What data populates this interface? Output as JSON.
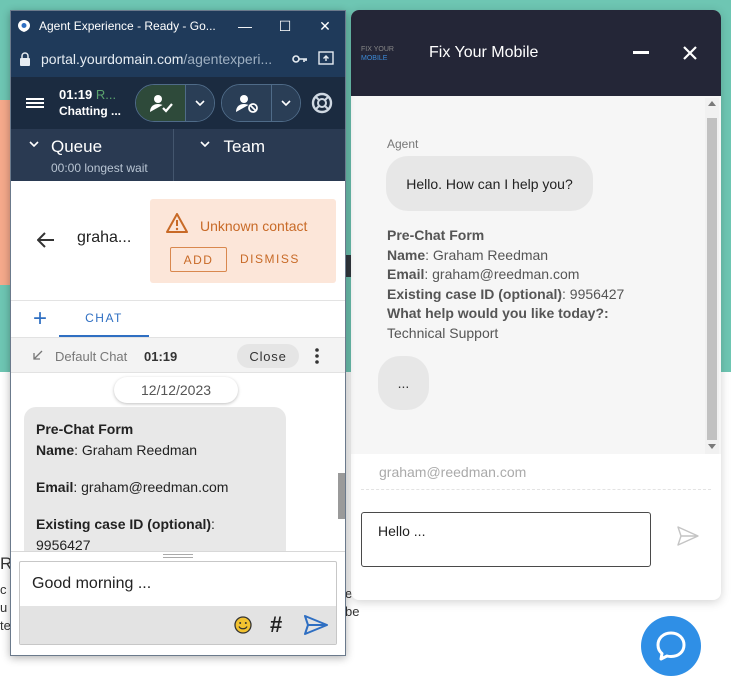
{
  "background": {
    "left_text_big": "R",
    "left_text_lines": [
      "c",
      "u",
      "te"
    ],
    "right_text_lines": [
      "e",
      "be"
    ]
  },
  "agent_window": {
    "title": "Agent Experience - Ready - Go...",
    "url_host": "portal.yourdomain.com",
    "url_path": "/agentexperi...",
    "timer": "01:19",
    "ready_short": "R...",
    "status_text": "Chatting ...",
    "queue": {
      "label": "Queue",
      "sub": "00:00 longest wait"
    },
    "team": {
      "label": "Team"
    },
    "contact_name": "graha...",
    "unknown_contact": {
      "label": "Unknown contact",
      "add": "ADD",
      "dismiss": "DISMISS"
    },
    "tab_chat": "CHAT",
    "tab_plus": "+",
    "chat_info": {
      "name": "Default Chat",
      "time": "01:19",
      "close": "Close"
    },
    "date": "12/12/2023",
    "message": {
      "title": "Pre-Chat Form",
      "name_label": "Name",
      "name_value": ": Graham Reedman",
      "email_label": "Email",
      "email_value": ": graham@reedman.com",
      "case_label": "Existing case ID (optional)",
      "case_value": ":",
      "case_number": "9956427"
    },
    "composer_text": "Good morning ...",
    "hash": "#"
  },
  "widget": {
    "logo_line1": "FIX YOUR",
    "logo_line2": "MOBILE",
    "title": "Fix Your Mobile",
    "agent_label": "Agent",
    "agent_message": "Hello. How can I help you?",
    "form": {
      "title": "Pre-Chat Form",
      "name_label": "Name",
      "name_value": ": Graham Reedman",
      "email_label": "Email",
      "email_value": ": graham@reedman.com",
      "case_label": "Existing case ID (optional)",
      "case_value": ": 9956427",
      "help_label": "What help would you like today?",
      "help_colon": ":",
      "help_value": "Technical Support"
    },
    "typing": "...",
    "email_field": "graham@reedman.com",
    "input_text": "Hello ..."
  },
  "colors": {
    "agent_titlebar": "#1f3a5a",
    "agent_toolbar": "#1b2b40",
    "queue_bar": "#2a3a52",
    "accent_blue": "#2f6fc2",
    "warning_orange": "#c86a27",
    "widget_header": "#242637",
    "launcher_blue": "#2f8fe6",
    "page_teal": "#6ec6b3"
  }
}
